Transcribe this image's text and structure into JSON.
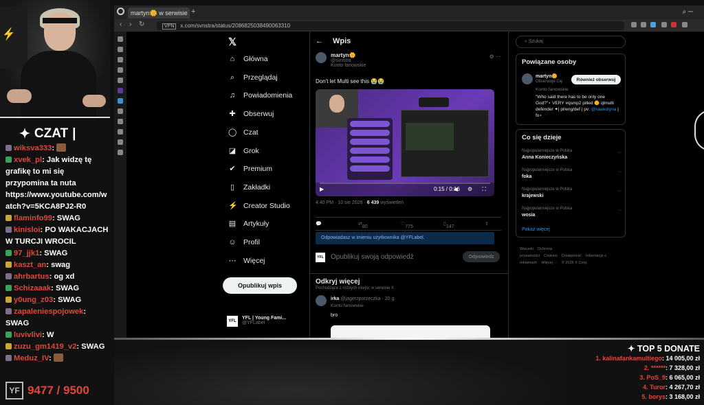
{
  "chat": {
    "title": "CZAT",
    "messages": [
      {
        "user": "wiksva333",
        "sep": ":",
        "text": ""
      },
      {
        "user": "xvek_pl",
        "sep": ":",
        "text": "Jak widzę tę grafikę to mi się przypomina ta nuta https://www.youtube.com/watch?v=5KCA8PJ2-R0"
      },
      {
        "user": "flaminfo99",
        "sep": ":",
        "text": "SWAG"
      },
      {
        "user": "kinisloi",
        "sep": ":",
        "text": "PO WAKACJACH W TURCJI WROCIL"
      },
      {
        "user": "97_jjk1",
        "sep": ":",
        "text": "SWAG"
      },
      {
        "user": "kaszt_an",
        "sep": ":",
        "text": "swag"
      },
      {
        "user": "ahrbartus",
        "sep": ":",
        "text": "og xd"
      },
      {
        "user": "Schizaaak",
        "sep": ":",
        "text": "SWAG"
      },
      {
        "user": "y0ung_z03",
        "sep": ":",
        "text": "SWAG"
      },
      {
        "user": "zapaleniespojowek",
        "sep": ":",
        "text": "SWAG"
      },
      {
        "user": "luvivlivi",
        "sep": ":",
        "text": "W"
      },
      {
        "user": "zuzu_gm1419_v2",
        "sep": ":",
        "text": "SWAG"
      },
      {
        "user": "Meduz_IV",
        "sep": ":",
        "text": ""
      }
    ]
  },
  "goal": {
    "current": "9477",
    "sep": "/",
    "target": "9500",
    "text": "9477 / 9500"
  },
  "browser": {
    "tab_title": "martyn🌼 w serwisie X: „Do...",
    "url": "x.com/svnstra/status/2086825038490063310",
    "vpn": "VPN"
  },
  "x": {
    "nav": [
      {
        "label": "Główna",
        "icon": "home-icon",
        "glyph": "⌂"
      },
      {
        "label": "Przeglądaj",
        "icon": "search-icon",
        "glyph": "⌕"
      },
      {
        "label": "Powiadomienia",
        "icon": "bell-icon",
        "glyph": "♫"
      },
      {
        "label": "Obserwuj",
        "icon": "follow-icon",
        "glyph": "✚"
      },
      {
        "label": "Czat",
        "icon": "chat-icon",
        "glyph": "◯"
      },
      {
        "label": "Grok",
        "icon": "grok-icon",
        "glyph": "◪"
      },
      {
        "label": "Premium",
        "icon": "premium-icon",
        "glyph": "✔"
      },
      {
        "label": "Zakładki",
        "icon": "bookmark-icon",
        "glyph": "▯"
      },
      {
        "label": "Creator Studio",
        "icon": "creator-icon",
        "glyph": "⚡"
      },
      {
        "label": "Artykuły",
        "icon": "articles-icon",
        "glyph": "▤"
      },
      {
        "label": "Profil",
        "icon": "profile-icon",
        "glyph": "☺"
      },
      {
        "label": "Więcej",
        "icon": "more-icon",
        "glyph": "⋯"
      }
    ],
    "post_button": "Opublikuj wpis",
    "account": {
      "name": "YFL | Young Fami...",
      "handle": "@YFLabel",
      "avatar_text": "YFL"
    },
    "main": {
      "header": "Wpis",
      "author": {
        "name": "martyn🌼",
        "handle": "@svnstra",
        "sub": "Konto fanowskie"
      },
      "text": "Don't let Multi see this 😭😭",
      "video": {
        "time": "0:15 / 0:16"
      },
      "meta": {
        "time": "4:40 PM",
        "date": "10 sie 2026",
        "views": "6 439",
        "views_label": "wyświetleń"
      },
      "actions": {
        "replies": "",
        "reposts": "80",
        "likes": "775",
        "bookmarks": "147"
      },
      "reply_as": "Odpowiadasz w imieniu użytkownika @YFLabel.",
      "reply_placeholder": "Opublikuj swoją odpowiedź",
      "reply_button": "Odpowiedz",
      "discover": {
        "title": "Odkryj więcej",
        "subtitle": "Pochodzące z różnych miejsc w serwisie X"
      },
      "disc_post": {
        "name": "irka",
        "meta": "@jagerzporzeczka · 20 g.",
        "sub": "Konto fanowskie",
        "text": "bro"
      }
    },
    "right": {
      "search_placeholder": "Szukaj",
      "related": {
        "title": "Powiązane osoby",
        "name": "martyn🌼",
        "handle": "Obserwuje Cię",
        "follow_button": "Również obserwuj",
        "sub": "Konto fanowskie",
        "bio": "\"Who said there has to be only one God?\"⋆ VERY #qsmp2 pilled 🌼 qlmulti defender ✦| pl/eng/def | pv:",
        "bio_link": "@naukotyna",
        "bio_tail": " | fo⋆"
      },
      "happening": {
        "title": "Co się dzieje",
        "trends": [
          {
            "category": "Najpopularniejsze w Polska",
            "name": "Anna Konieczyńska"
          },
          {
            "category": "Najpopularniejsze w Polska",
            "name": "foka"
          },
          {
            "category": "Najpopularniejsze w Polska",
            "name": "krajewski"
          },
          {
            "category": "Najpopularniejsze w Polska",
            "name": "wosia"
          }
        ],
        "show_more": "Pokaż więcej"
      },
      "footer": [
        "Warunki",
        "Ochrona prywatności",
        "Cookies",
        "Dostępność",
        "Informacje o reklamach",
        "Więcej ···",
        "© 2026 X Corp."
      ]
    }
  },
  "donate": {
    "title": "TOP 5 DONATE",
    "entries": [
      {
        "rank": "1.",
        "name": "kalinafankamultiego",
        "amount": "14 005,00 zł"
      },
      {
        "rank": "2.",
        "name": "******",
        "amount": "7 328,00 zł"
      },
      {
        "rank": "3.",
        "name": "PoS_9",
        "amount": "6 065,00 zł"
      },
      {
        "rank": "4.",
        "name": "Turor",
        "amount": "4 267,70 zł"
      },
      {
        "rank": "5.",
        "name": "borys",
        "amount": "3 168,00 zł"
      }
    ]
  },
  "colors": {
    "accent_red": "#e0473a",
    "x_blue": "#1d9bf0",
    "purple": "#6b3bb8"
  }
}
